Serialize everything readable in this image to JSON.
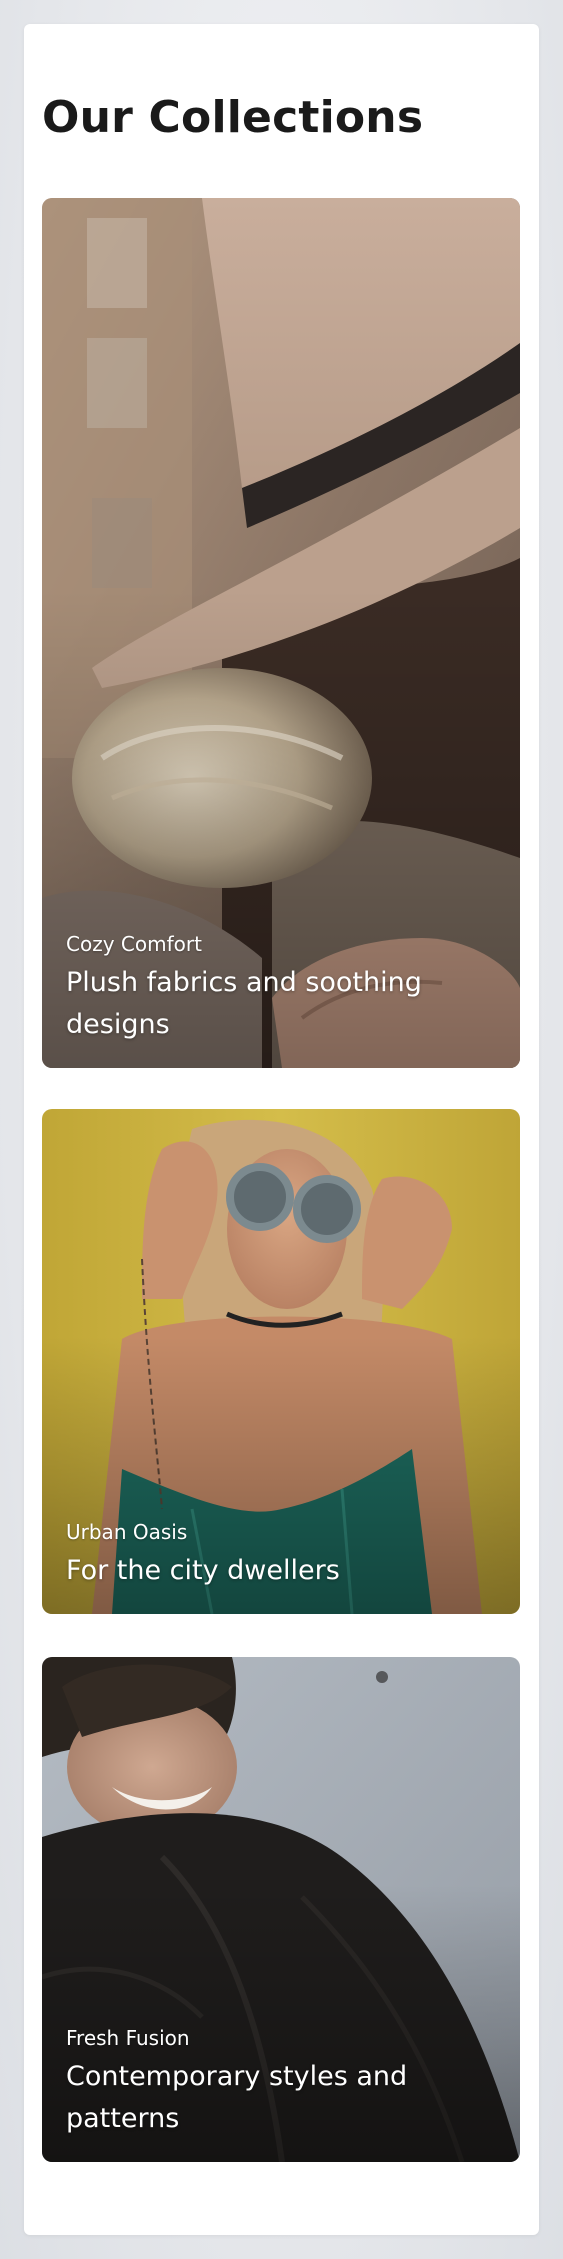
{
  "page": {
    "title": "Our Collections"
  },
  "collections": [
    {
      "eyebrow": "Cozy Comfort",
      "headline": "Plush fabrics and soothing designs"
    },
    {
      "eyebrow": "Urban Oasis",
      "headline": "For the city dwellers"
    },
    {
      "eyebrow": "Fresh Fusion",
      "headline": "Contemporary styles and patterns"
    }
  ],
  "colors": {
    "background": "#e4e6ea",
    "panel": "#ffffff",
    "title_text": "#1a1a1a",
    "caption_text": "#ffffff",
    "card1_hat": "#c4aa98",
    "card2_wall": "#c9b13a",
    "card3_wall": "#a9b0b8"
  },
  "images": {
    "card1": "woman-in-felt-hat-photo",
    "card2": "woman-with-round-sunglasses-photo",
    "card3": "laughing-man-in-black-coat-photo"
  }
}
